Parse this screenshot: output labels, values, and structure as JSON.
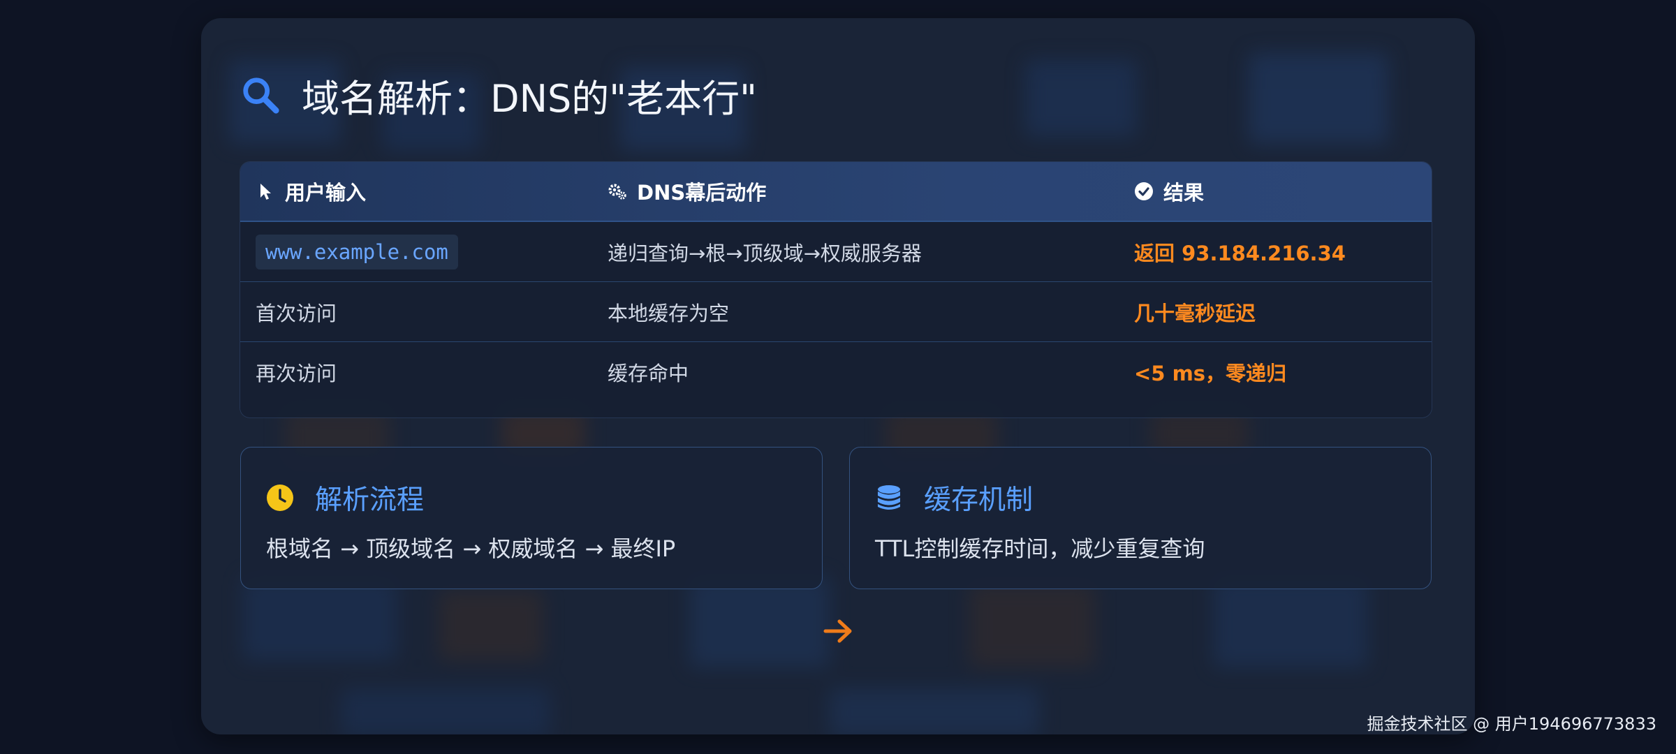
{
  "slide": {
    "title": "域名解析：DNS的\"老本行\"",
    "title_icon": "search-icon",
    "accent_color": "#3b82f6",
    "highlight_color": "#ff8a1f"
  },
  "table": {
    "headers": [
      {
        "label": "用户输入",
        "icon": "cursor-icon"
      },
      {
        "label": "DNS幕后动作",
        "icon": "gears-icon"
      },
      {
        "label": "结果",
        "icon": "check-circle-icon"
      }
    ],
    "rows": [
      {
        "input": "www.example.com",
        "action": "递归查询→根→顶级域→权威服务器",
        "result": "返回 93.184.216.34"
      },
      {
        "input": "首次访问",
        "action": "本地缓存为空",
        "result": "几十毫秒延迟"
      },
      {
        "input": "再次访问",
        "action": "缓存命中",
        "result": "<5 ms，零递归"
      }
    ]
  },
  "cards": [
    {
      "title": "解析流程",
      "icon": "clock-icon",
      "body": "根域名 → 顶级域名 → 权威域名 → 最终IP"
    },
    {
      "title": "缓存机制",
      "icon": "database-icon",
      "body": "TTL控制缓存时间，减少重复查询"
    }
  ],
  "next_icon": "arrow-right-icon",
  "watermark": "掘金技术社区 @ 用户194696773833"
}
